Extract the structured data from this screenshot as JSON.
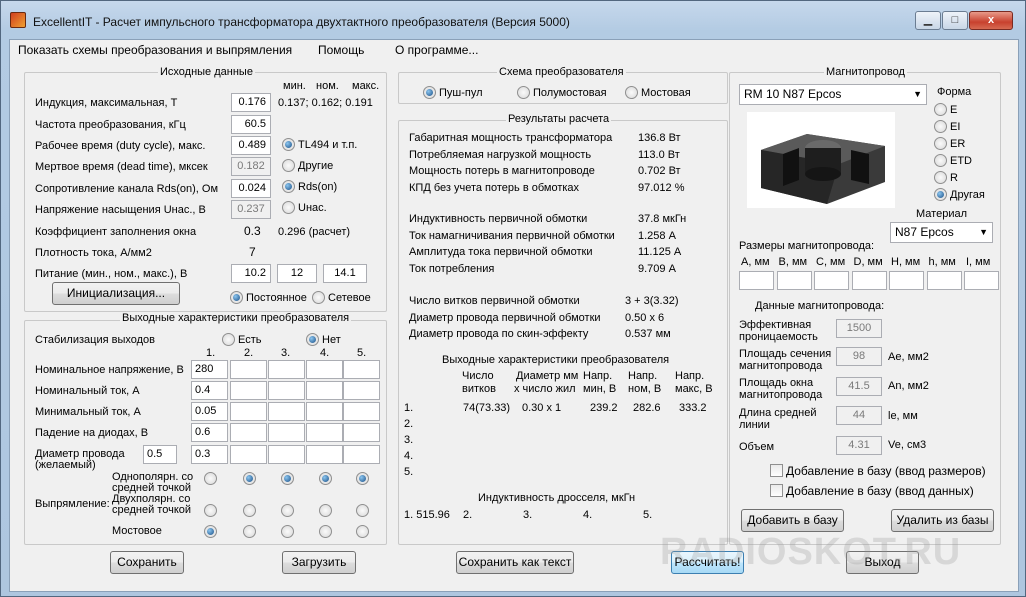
{
  "window": {
    "title": "ExcellentIT - Расчет импульсного трансформатора двухтактного преобразователя (Версия 5000)",
    "btn_min": "▁",
    "btn_max": "□",
    "btn_close": "x"
  },
  "menu": {
    "items": [
      "Показать схемы преобразования и выпрямления",
      "Помощь",
      "О программе..."
    ]
  },
  "input": {
    "title": "Исходные данные",
    "hdr_min": "мин.",
    "hdr_nom": "ном.",
    "hdr_max": "макс.",
    "induction_label": "Индукция, максимальная, Т",
    "induction": "0.176",
    "induction_ref": "0.137; 0.162; 0.191",
    "freq_label": "Частота преобразования, кГц",
    "freq": "60.5",
    "duty_label": "Рабочее время (duty cycle), макс.",
    "duty": "0.489",
    "tl494": "TL494 и т.п.",
    "dead_label": "Мертвое время (dead time), мксек",
    "dead": "0.182",
    "other": "Другие",
    "rds_label": "Сопротивление канала Rds(on), Ом",
    "rds": "0.024",
    "rds_opt": "Rds(on)",
    "usat_label": "Напряжение насыщения Uнас., В",
    "usat": "0.237",
    "usat_opt": "Uнас.",
    "fill_label": "Коэффициент заполнения окна",
    "fill": "0.3",
    "fill_calc": "0.296 (расчет)",
    "density_label": "Плотность тока, А/мм2",
    "density": "7",
    "supply_label": "Питание (мин., ном., макс.), В",
    "supply_min": "10.2",
    "supply_nom": "12",
    "supply_max": "14.1",
    "init_button": "Инициализация...",
    "dc": "Постоянное",
    "ac": "Сетевое"
  },
  "outputs": {
    "title": "Выходные характеристики преобразователя",
    "stab_label": "Стабилизация выходов",
    "stab_yes": "Есть",
    "stab_no": "Нет",
    "cols": [
      "1.",
      "2.",
      "3.",
      "4.",
      "5."
    ],
    "voltage_label": "Номинальное напряжение, В",
    "voltage": [
      "280",
      "",
      "",
      "",
      ""
    ],
    "current_label": "Номинальный ток, А",
    "current": [
      "0.4",
      "",
      "",
      "",
      ""
    ],
    "min_current_label": "Минимальный ток, А",
    "min_current": [
      "0.05",
      "",
      "",
      "",
      ""
    ],
    "diode_label": "Падение на диодах, В",
    "diode": [
      "0.6",
      "",
      "",
      "",
      ""
    ],
    "wire_label1": "Диаметр провода",
    "wire_label2": "(желаемый)",
    "wire_pre": "0.5",
    "wire": [
      "0.3",
      "",
      "",
      "",
      ""
    ],
    "rect_label": "Выпрямление:",
    "rect1a": "Однополярн. со",
    "rect1b": "средней точкой",
    "rect2a": "Двухполярн. со",
    "rect2b": "средней точкой",
    "rect3": "Мостовое"
  },
  "scheme": {
    "title": "Схема преобразователя",
    "push_pull": "Пуш-пул",
    "half_bridge": "Полумостовая",
    "bridge": "Мостовая"
  },
  "results": {
    "title": "Результаты расчета",
    "rows1": [
      {
        "label": "Габаритная мощность трансформатора",
        "value": "136.8 Вт"
      },
      {
        "label": "Потребляемая нагрузкой мощность",
        "value": "113.0 Вт"
      },
      {
        "label": "Мощность потерь в магнитопроводе",
        "value": "0.702 Вт"
      },
      {
        "label": "КПД без учета потерь в обмотках",
        "value": "97.012 %"
      }
    ],
    "rows2": [
      {
        "label": "Индуктивность первичной обмотки",
        "value": "37.8 мкГн"
      },
      {
        "label": "Ток намагничивания первичной обмотки",
        "value": "1.258 А"
      },
      {
        "label": "Амплитуда тока первичной обмотки",
        "value": "11.125 А"
      },
      {
        "label": "Ток потребления",
        "value": "9.709 А"
      }
    ],
    "rows3": [
      {
        "label": "Число витков первичной обмотки",
        "value": "3 + 3(3.32)"
      },
      {
        "label": "Диаметр провода первичной обмотки",
        "value": "0.50 x 6"
      },
      {
        "label": "Диаметр провода по скин-эффекту",
        "value": "0.537 мм"
      }
    ],
    "out_title": "Выходные характеристики преобразователя",
    "col_turns_a": "Число",
    "col_turns_b": "витков",
    "col_dia_a": "Диаметр мм",
    "col_dia_b": "x число жил",
    "col_vmin_a": "Напр.",
    "col_vmin_b": "мин, В",
    "col_vnom_a": "Напр.",
    "col_vnom_b": "ном, В",
    "col_vmax_a": "Напр.",
    "col_vmax_b": "макс, В",
    "out_rows": [
      {
        "n": "1.",
        "turns": "74(73.33)",
        "dia": "0.30 x 1",
        "vmin": "239.2",
        "vnom": "282.6",
        "vmax": "333.2"
      },
      {
        "n": "2."
      },
      {
        "n": "3."
      },
      {
        "n": "4."
      },
      {
        "n": "5."
      }
    ],
    "choke_title": "Индуктивность дросселя, мкГн",
    "choke": [
      "1. 515.96",
      "2.",
      "3.",
      "4.",
      "5."
    ]
  },
  "core": {
    "title": "Магнитопровод",
    "model": "RM 10 N87 Epcos",
    "shape_label": "Форма",
    "shapes": [
      "E",
      "EI",
      "ER",
      "ETD",
      "R",
      "Другая"
    ],
    "material_label": "Материал",
    "material": "N87 Epcos",
    "dims_label": "Размеры магнитопровода:",
    "dims": [
      "A, мм",
      "B, мм",
      "C, мм",
      "D, мм",
      "H, мм",
      "h, мм",
      "I, мм"
    ],
    "data_label": "Данные магнитопровода:",
    "perm_a": "Эффективная",
    "perm_b": "проницаемость",
    "perm": "1500",
    "ae_a": "Площадь сечения",
    "ae_b": "магнитопровода",
    "ae": "98",
    "ae_unit": "Ae, мм2",
    "an_a": "Площадь окна",
    "an_b": "магнитопровода",
    "an": "41.5",
    "an_unit": "An, мм2",
    "le_a": "Длина средней",
    "le_b": "линии",
    "le": "44",
    "le_unit": "le, мм",
    "ve_label": "Объем",
    "ve": "4.31",
    "ve_unit": "Ve, см3",
    "add_dims": "Добавление в базу (ввод размеров)",
    "add_data": "Добавление в базу (ввод данных)",
    "add_button": "Добавить в базу",
    "del_button": "Удалить из базы"
  },
  "bottom": {
    "save": "Сохранить",
    "load": "Загрузить",
    "save_text": "Сохранить как текст",
    "calc": "Рассчитать!",
    "exit": "Выход"
  },
  "watermark": "RADIOSKOT.RU"
}
